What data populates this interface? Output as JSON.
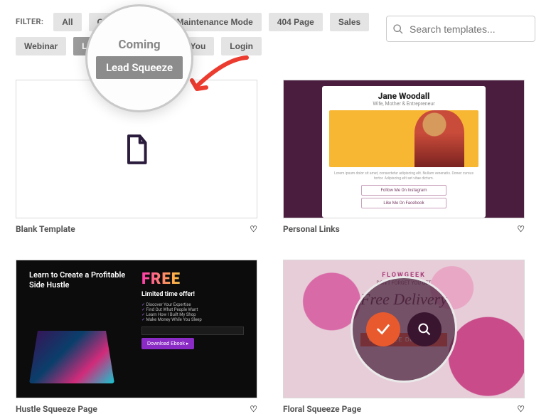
{
  "filter_label": "FILTER:",
  "filters": {
    "row1": [
      "All",
      "Coming Soon",
      "Maintenance Mode",
      "404 Page",
      "Sales"
    ],
    "row2": [
      "Webinar",
      "Lead Squeeze",
      "Thank You",
      "Login"
    ]
  },
  "active_filter": "Lead Squeeze",
  "search": {
    "placeholder": "Search templates..."
  },
  "zoom_bubble": {
    "top_text": "Coming",
    "tag_text": "Lead Squeeze"
  },
  "templates": [
    {
      "title": "Blank Template"
    },
    {
      "title": "Personal Links",
      "pl": {
        "name": "Jane Woodall",
        "subtitle": "Wife, Mother & Entrepreneur",
        "lorem": "Lorem ipsum dolor sit amet, consectetur adipiscing elit. Nullam venenatis. Donec cursus tortor. Adipiscing elit set vitae dictum.",
        "btn1": "Follow Me On Instagram",
        "btn2": "Like Me On Facebook"
      }
    },
    {
      "title": "Hustle Squeeze Page",
      "h": {
        "headline": "Learn to Create a Profitable Side Hustle",
        "free": "FREE",
        "limited": "Limited time offer!",
        "bullets": [
          "Discover Your Expertise",
          "Find Out What People Want",
          "Learn How I Built My Shop",
          "Make Money While You Sleep"
        ],
        "cta": "Download Ebook ▸"
      }
    },
    {
      "title": "Floral Squeeze Page",
      "f": {
        "brand": "FLOWGEEK",
        "sub": "DON'T FORGET YOU GET",
        "main": "Free Delivery",
        "cta": "GET FREE DELIVERY"
      }
    }
  ]
}
